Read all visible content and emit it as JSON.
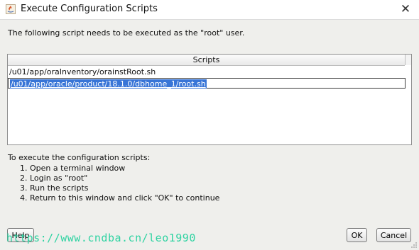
{
  "window": {
    "title": "Execute Configuration Scripts",
    "icon": "java-app-icon",
    "close_icon": "close-icon"
  },
  "intro_text": "The following script needs to be executed as the \"root\" user.",
  "table": {
    "header": "Scripts",
    "rows": [
      "/u01/app/oraInventory/orainstRoot.sh",
      "/u01/app/oracle/product/18.1.0/dbhome_1/root.sh"
    ],
    "selected_row": 1
  },
  "instructions": {
    "heading": "To execute the configuration scripts:",
    "steps": [
      "1. Open a terminal window",
      "2. Login as \"root\"",
      "3. Run the scripts",
      "4. Return to this window and click \"OK\" to continue"
    ]
  },
  "buttons": {
    "help": "Help",
    "ok": "OK",
    "cancel": "Cancel"
  },
  "watermark": "https://www.cndba.cn/leo1990"
}
